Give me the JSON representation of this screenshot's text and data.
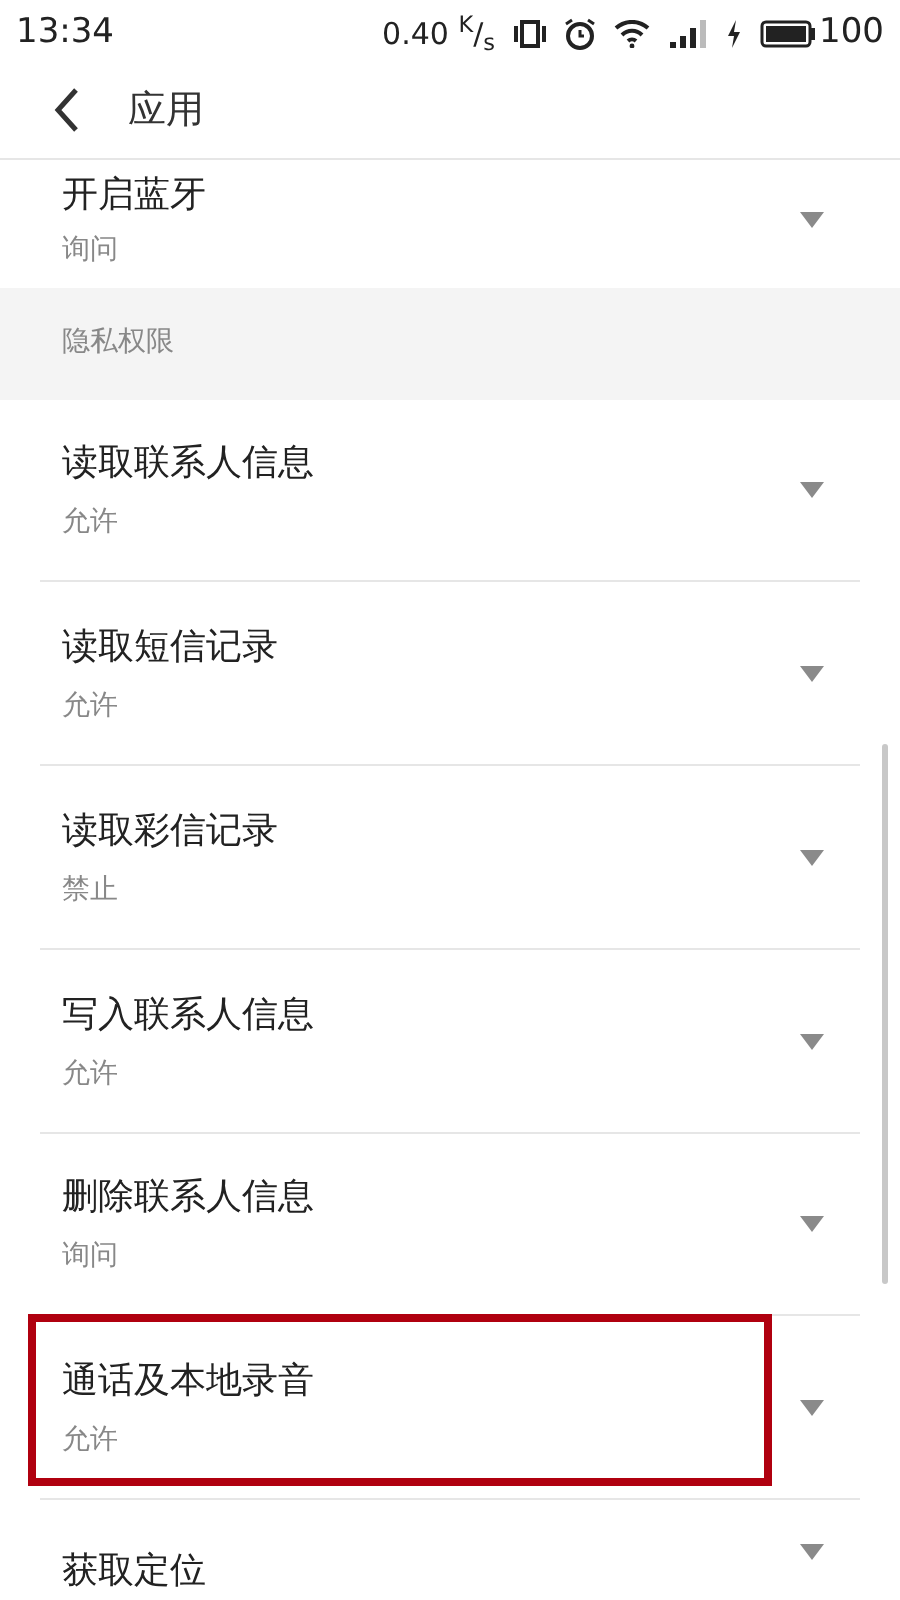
{
  "status_bar": {
    "time": "13:34",
    "speed": "0.40 $^{K}$/$_{s}$",
    "battery": "100"
  },
  "header": {
    "title": "应用"
  },
  "top_item": {
    "title": "开启蓝牙",
    "value": "询问"
  },
  "section": {
    "title": "隐私权限"
  },
  "items": [
    {
      "title": "读取联系人信息",
      "value": "允许",
      "highlighted": false
    },
    {
      "title": "读取短信记录",
      "value": "允许",
      "highlighted": false
    },
    {
      "title": "读取彩信记录",
      "value": "禁止",
      "highlighted": false
    },
    {
      "title": "写入联系人信息",
      "value": "允许",
      "highlighted": false
    },
    {
      "title": "删除联系人信息",
      "value": "询问",
      "highlighted": false
    },
    {
      "title": "通话及本地录音",
      "value": "允许",
      "highlighted": true
    },
    {
      "title": "获取定位",
      "highlighted": false
    }
  ]
}
